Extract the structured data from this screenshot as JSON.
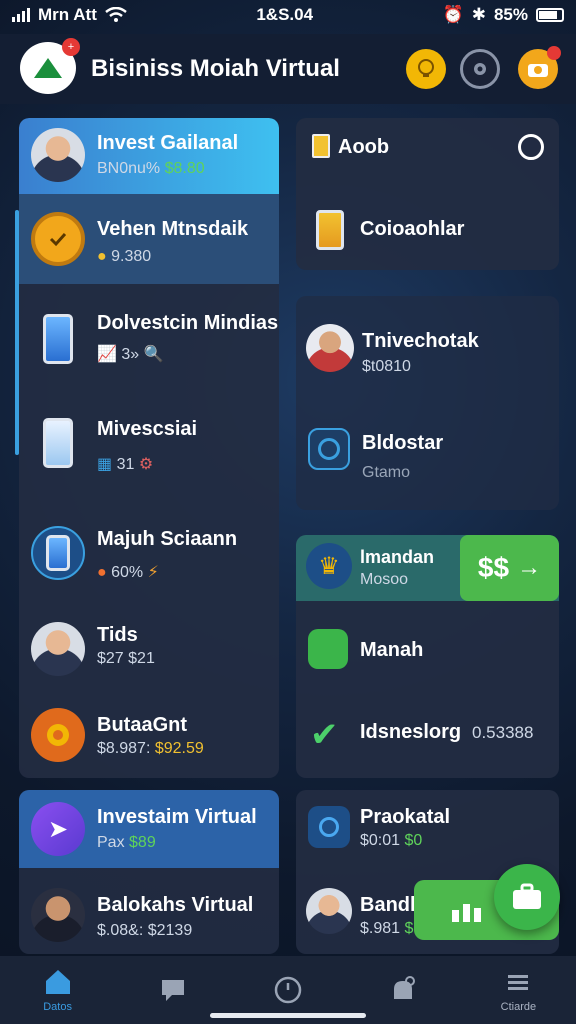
{
  "status_bar": {
    "carrier": "Mrn Att",
    "time": "1&S.04",
    "battery": "85%"
  },
  "header": {
    "title": "Bisiniss Moiah Virtual"
  },
  "left_panel": {
    "items": [
      {
        "title": "Invest Gailanal",
        "subtitle": "BN0nu%",
        "amount": "$8.80"
      },
      {
        "title": "Vehen Mtnsdaik",
        "subtitle": "9.380"
      },
      {
        "title": "Dolvestcin Mindiasil",
        "subtitle": "3»"
      },
      {
        "title": "Mivescsiai",
        "subtitle": "31"
      },
      {
        "title": "Majuh Sciaann",
        "subtitle": "60%"
      },
      {
        "title": "Tids",
        "subtitle": "$27 $21"
      },
      {
        "title": "ButaaGnt",
        "subtitle": "$8.987:",
        "amount": "$92.59"
      }
    ]
  },
  "right_panel_top": {
    "items": [
      {
        "title": "Aoob"
      },
      {
        "title": "Coioaohlar"
      }
    ]
  },
  "right_panel_mid": {
    "items": [
      {
        "title": "Tnivechotak",
        "subtitle": "$t0810"
      },
      {
        "title": "Bldostar",
        "subtitle": "Gtamo"
      }
    ]
  },
  "right_panel_lower": {
    "items": [
      {
        "title": "lmandan",
        "subtitle": "Mosoo",
        "action": "$$"
      },
      {
        "title": "Manah"
      },
      {
        "title": "Idsneslorg",
        "amount": "0.53388"
      }
    ]
  },
  "left_panel_bottom": {
    "items": [
      {
        "title": "Investaim Virtual",
        "subtitle": "Pax",
        "amount": "$89"
      },
      {
        "title": "Balokahs Virtual",
        "subtitle": "$.08&:",
        "amount": "$2139"
      }
    ]
  },
  "right_panel_bottom": {
    "items": [
      {
        "title": "Praokatal",
        "subtitle": "$0:01",
        "amount": "$0"
      },
      {
        "title": "Bandh",
        "subtitle": "$.981",
        "amount": "$"
      }
    ]
  },
  "bottom_nav": {
    "items": [
      {
        "label": "Datos"
      },
      {
        "label": ""
      },
      {
        "label": ""
      },
      {
        "label": ""
      },
      {
        "label": "Ctiarde"
      }
    ]
  },
  "colors": {
    "accent_green": "#3bb54a",
    "accent_blue": "#2f8fd8",
    "gold": "#f2b705"
  }
}
